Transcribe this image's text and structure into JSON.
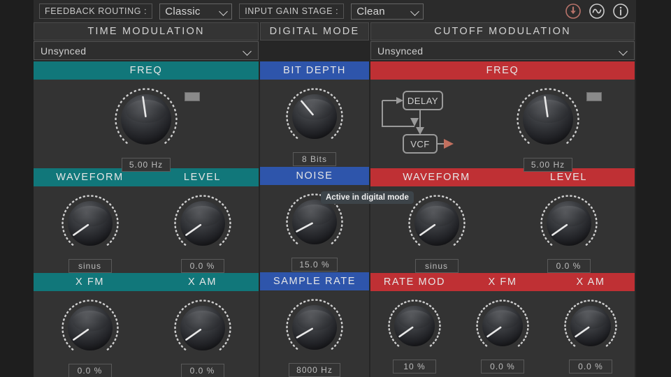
{
  "topbar": {
    "feedback_label": "FEEDBACK ROUTING :",
    "feedback_value": "Classic",
    "input_gain_label": "INPUT GAIN STAGE :",
    "input_gain_value": "Clean",
    "icons": [
      "download-circle-icon",
      "sine-wave-circle-icon",
      "info-circle-icon"
    ]
  },
  "sections": {
    "time": "TIME MODULATION",
    "digital": "DIGITAL MODE",
    "cutoff": "CUTOFF MODULATION"
  },
  "sync": {
    "time_value": "Unsynced",
    "cutoff_value": "Unsynced"
  },
  "routing_diagram": {
    "delay_label": "DELAY",
    "vcf_label": "VCF"
  },
  "tooltip": {
    "text": "Active in digital mode"
  },
  "colors": {
    "teal": "#11777a",
    "blue": "#2e55ab",
    "red": "#bf3034",
    "panel": "#333333",
    "accent_arrow": "#c2705f"
  },
  "time_modulation": {
    "row1": [
      {
        "label": "FREQ",
        "value": "5.00 Hz",
        "angle": -8,
        "has_led": true
      }
    ],
    "row2": [
      {
        "label": "WAVEFORM",
        "value": "sinus",
        "angle": -125
      },
      {
        "label": "LEVEL",
        "value": "0.0 %",
        "angle": -125
      }
    ],
    "row3": [
      {
        "label": "X FM",
        "value": "0.0 %",
        "angle": -125
      },
      {
        "label": "X AM",
        "value": "0.0 %",
        "angle": -125
      }
    ]
  },
  "digital_mode": {
    "row1": [
      {
        "label": "BIT DEPTH",
        "value": "8 Bits",
        "angle": -40
      }
    ],
    "row2": [
      {
        "label": "NOISE",
        "value": "15.0 %",
        "angle": -118
      }
    ],
    "row3": [
      {
        "label": "SAMPLE RATE",
        "value": "8000 Hz",
        "angle": -120
      }
    ]
  },
  "cutoff_modulation": {
    "row1": [
      {
        "label": "FREQ",
        "value": "5.00 Hz",
        "angle": -8,
        "has_led": true
      }
    ],
    "row2": [
      {
        "label": "WAVEFORM",
        "value": "sinus",
        "angle": -125
      },
      {
        "label": "LEVEL",
        "value": "0.0 %",
        "angle": -125
      }
    ],
    "row3": [
      {
        "label": "RATE MOD",
        "value": "10 %",
        "angle": -125
      },
      {
        "label": "X FM",
        "value": "0.0 %",
        "angle": -125
      },
      {
        "label": "X AM",
        "value": "0.0 %",
        "angle": -125
      }
    ]
  }
}
